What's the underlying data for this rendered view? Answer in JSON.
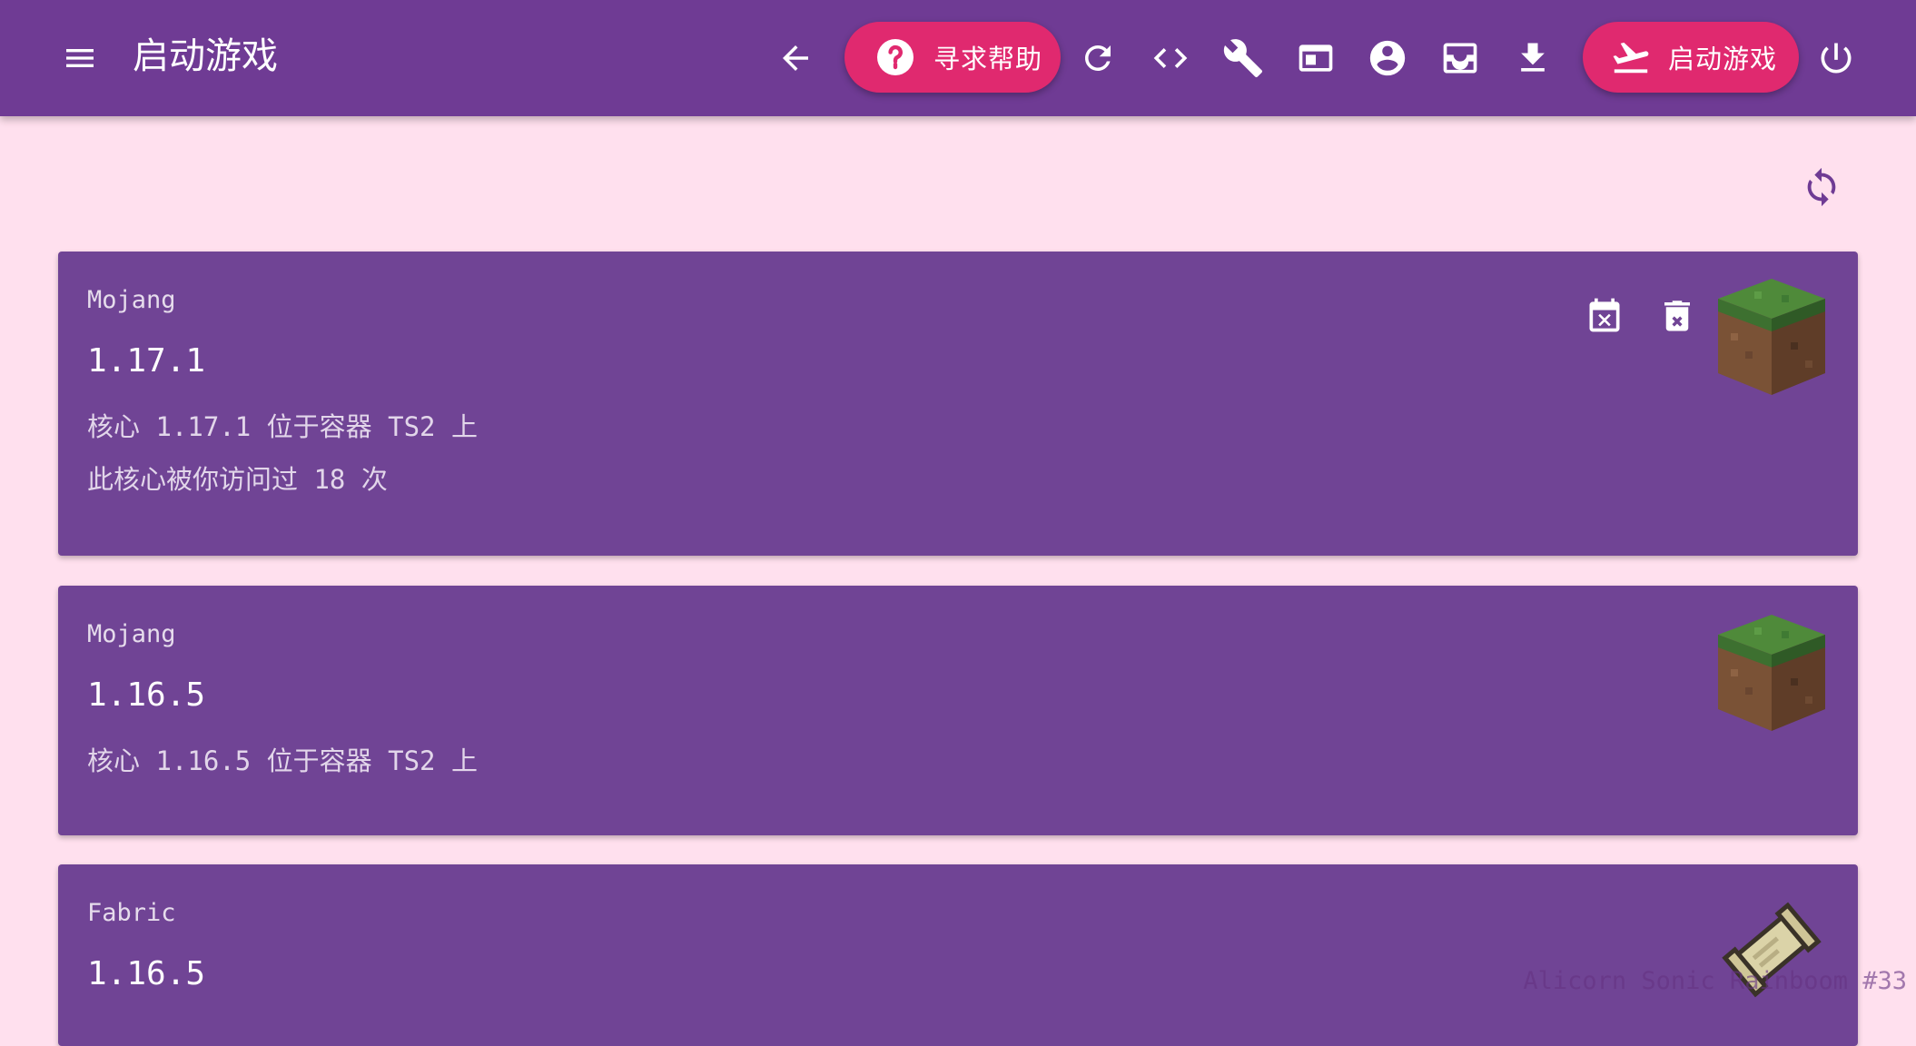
{
  "appbar": {
    "title": "启动游戏",
    "help_label": "寻求帮助",
    "launch_label": "启动游戏",
    "icons": [
      "menu-icon",
      "arrow-back-icon",
      "help-circle-icon",
      "refresh-icon",
      "code-icon",
      "wrench-icon",
      "web-asset-icon",
      "account-circle-icon",
      "inbox-tray-icon",
      "download-icon",
      "flight-takeoff-icon",
      "power-icon"
    ]
  },
  "cards": [
    {
      "source": "Mojang",
      "version": "1.17.1",
      "line1": "核心 1.17.1 位于容器 TS2 上",
      "line2": "此核心被你访问过 18 次",
      "thumbnail": "grass-block-icon",
      "actions": [
        "calendar-remove-icon",
        "delete-icon"
      ]
    },
    {
      "source": "Mojang",
      "version": "1.16.5",
      "line1": "核心 1.16.5 位于容器 TS2 上",
      "thumbnail": "grass-block-icon"
    },
    {
      "source": "Fabric",
      "version": "1.16.5",
      "thumbnail": "fabric-scroll-icon"
    }
  ],
  "watermark": "Alicorn Sonic Rainboom #33",
  "colors": {
    "appbar": "#6f3b94",
    "accent": "#e0296f",
    "background": "#ffe0ee",
    "card": "#704495"
  }
}
